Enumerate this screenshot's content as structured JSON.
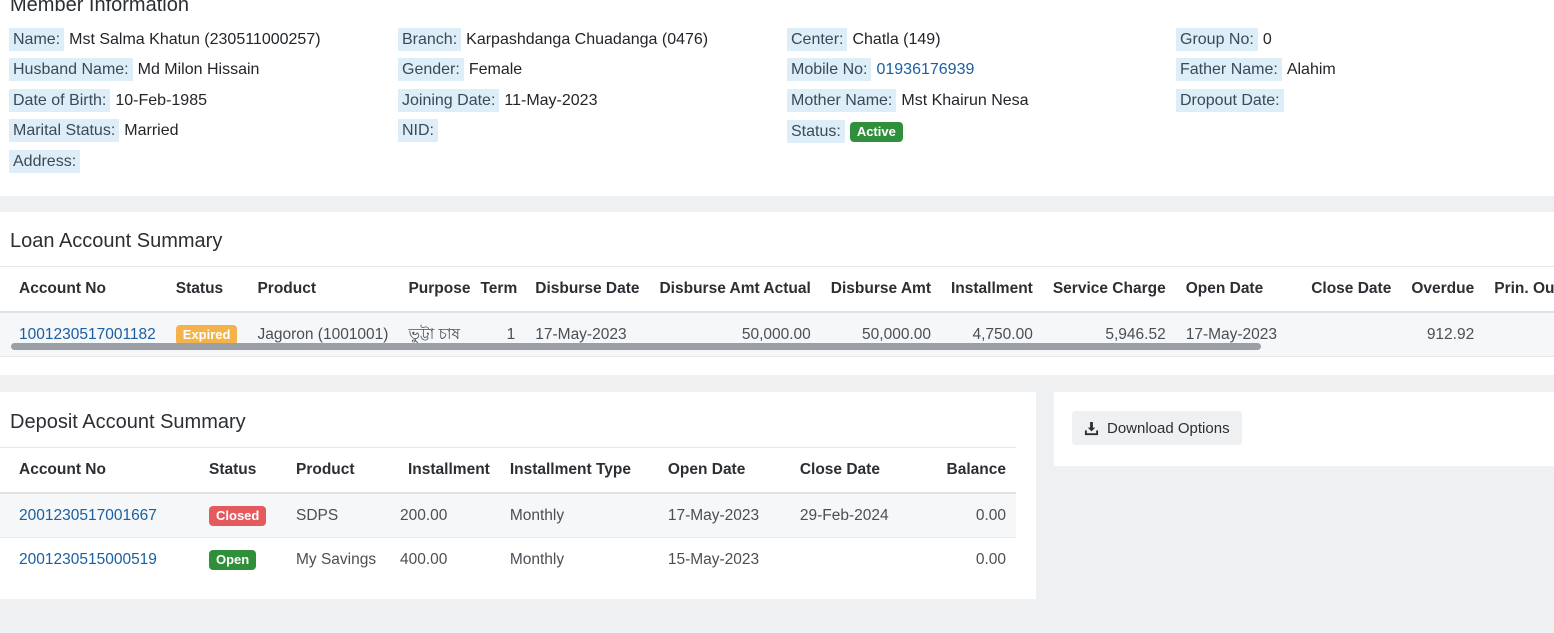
{
  "member": {
    "title": "Member Information",
    "fields": {
      "name": {
        "label": "Name:",
        "value": "Mst Salma Khatun (230511000257)"
      },
      "branch": {
        "label": "Branch:",
        "value": "Karpashdanga Chuadanga (0476)"
      },
      "center": {
        "label": "Center:",
        "value": "Chatla (149)"
      },
      "group": {
        "label": "Group No:",
        "value": "0"
      },
      "husband": {
        "label": "Husband Name:",
        "value": "Md Milon Hissain"
      },
      "gender": {
        "label": "Gender:",
        "value": "Female"
      },
      "mobile": {
        "label": "Mobile No:",
        "value": "01936176939"
      },
      "father": {
        "label": "Father Name:",
        "value": "Alahim"
      },
      "dob": {
        "label": "Date of Birth:",
        "value": "10-Feb-1985"
      },
      "joining": {
        "label": "Joining Date:",
        "value": "11-May-2023"
      },
      "mother": {
        "label": "Mother Name:",
        "value": "Mst Khairun Nesa"
      },
      "dropout": {
        "label": "Dropout Date:",
        "value": ""
      },
      "marital": {
        "label": "Marital Status:",
        "value": "Married"
      },
      "nid": {
        "label": "NID:",
        "value": ""
      },
      "status": {
        "label": "Status:",
        "value": "Active"
      },
      "address": {
        "label": "Address:",
        "value": ""
      }
    }
  },
  "loan": {
    "title": "Loan Account Summary",
    "headers": [
      "Account No",
      "Status",
      "Product",
      "Purpose",
      "Term",
      "Disburse Date",
      "Disburse Amt Actual",
      "Disburse Amt",
      "Installment",
      "Service Charge",
      "Open Date",
      "Close Date",
      "Overdue",
      "Prin. Ou"
    ],
    "row": {
      "account_no": "1001230517001182",
      "status": "Expired",
      "product": "Jagoron (1001001)",
      "purpose": "ভুট্টা চাষ",
      "term": "1",
      "disburse_date": "17-May-2023",
      "disburse_amt_actual": "50,000.00",
      "disburse_amt": "50,000.00",
      "installment": "4,750.00",
      "service_charge": "5,946.52",
      "open_date": "17-May-2023",
      "close_date": "",
      "overdue": "912.92",
      "prin_outstanding": ""
    }
  },
  "deposit": {
    "title": "Deposit Account Summary",
    "headers": [
      "Account No",
      "Status",
      "Product",
      "Installment",
      "Installment Type",
      "Open Date",
      "Close Date",
      "Balance"
    ],
    "rows": [
      {
        "account_no": "2001230517001667",
        "status": "Closed",
        "product": "SDPS",
        "installment": "200.00",
        "installment_type": "Monthly",
        "open_date": "17-May-2023",
        "close_date": "29-Feb-2024",
        "balance": "0.00"
      },
      {
        "account_no": "2001230515000519",
        "status": "Open",
        "product": "My Savings",
        "installment": "400.00",
        "installment_type": "Monthly",
        "open_date": "15-May-2023",
        "close_date": "",
        "balance": "0.00"
      }
    ]
  },
  "download": {
    "label": "Download Options",
    "icon": "download-icon"
  },
  "colors": {
    "accent_link": "#1a5fa0",
    "active": "#2f8f3a",
    "expired": "#f4b24a",
    "closed": "#e45a5f",
    "label_bg": "#ddeef8"
  }
}
